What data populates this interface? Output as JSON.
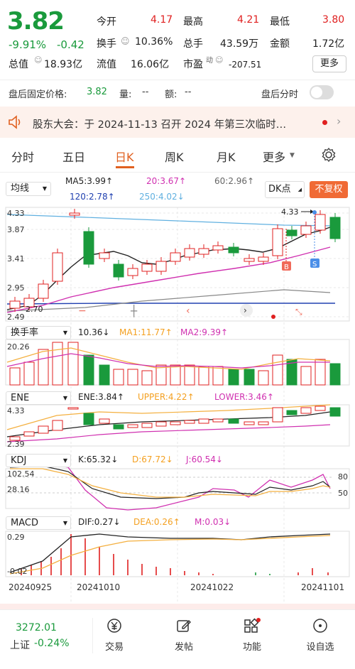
{
  "quote": {
    "price": "3.82",
    "change_pct": "-9.91%",
    "change": "-0.42",
    "open_label": "今开",
    "open": "4.17",
    "high_label": "最高",
    "high": "4.21",
    "low_label": "最低",
    "low": "3.80",
    "turnover_label": "换手",
    "turnover": "10.36%",
    "volume_label": "总手",
    "volume": "43.59万",
    "amount_label": "金额",
    "amount": "1.72亿",
    "mktcap_label": "总值",
    "mktcap": "18.93亿",
    "float_label": "流值",
    "float": "16.06亿",
    "pe_label": "市盈",
    "pe_sup": "动",
    "pe": "-207.51",
    "more_label": "更多"
  },
  "after_hours": {
    "fixed_price_label": "盘后固定价格:",
    "fixed_price": "3.82",
    "vol_label": "量:",
    "vol": "--",
    "amt_label": "额:",
    "amt": "--",
    "intraday_label": "盘后分时"
  },
  "notice": {
    "text": "股东大会：于 2024-11-13 召开 2024 年第三次临时…"
  },
  "period_tabs": [
    "分时",
    "五日",
    "日K",
    "周K",
    "月K",
    "更多"
  ],
  "active_tab": "日K",
  "ma": {
    "selector": "均线",
    "ma5": "MA5:3.99↑",
    "ma20": "20:3.67↑",
    "ma60": "60:2.96↑",
    "ma120": "120:2.78↑",
    "ma250": "250:4.02↓",
    "dk_label": "DK点",
    "adjust_label": "不复权"
  },
  "price_axis": [
    "4.33",
    "3.87",
    "3.41",
    "2.95",
    "2.49"
  ],
  "annot": {
    "high_mark": "4.33",
    "low_mark": "2.70",
    "buy": "B",
    "sell": "S"
  },
  "turnover_ind": {
    "selector": "换手率",
    "val": "10.36↓",
    "ma1": "MA1:11.77↑",
    "ma2": "MA2:9.39↑",
    "axis_top": "20.26"
  },
  "ene": {
    "selector": "ENE",
    "val": "ENE:3.84↑",
    "upper": "UPPER:4.22↑",
    "lower": "LOWER:3.46↑",
    "axis_top": "4.33",
    "axis_bot": "2.39"
  },
  "kdj": {
    "selector": "KDJ",
    "k": "K:65.32↓",
    "d": "D:67.72↓",
    "j": "J:60.54↓",
    "axis_top": "102.54",
    "axis_bot": "28.16",
    "lvl80": "80",
    "lvl50": "50"
  },
  "macd": {
    "selector": "MACD",
    "dif": "DIF:0.27↓",
    "dea": "DEA:0.26↑",
    "m": "M:0.03↓",
    "axis_top": "0.29",
    "axis_bot": "-0.02"
  },
  "dates": [
    "20240925",
    "20241010",
    "20241022",
    "20241101"
  ],
  "index": {
    "value": "3272.01",
    "name": "上证",
    "chg": "-0.24%"
  },
  "bottom_nav": [
    "交易",
    "发帖",
    "功能",
    "设自选"
  ],
  "colors": {
    "up": "#e02020",
    "down": "#1a9a3c",
    "accent": "#e06020"
  }
}
